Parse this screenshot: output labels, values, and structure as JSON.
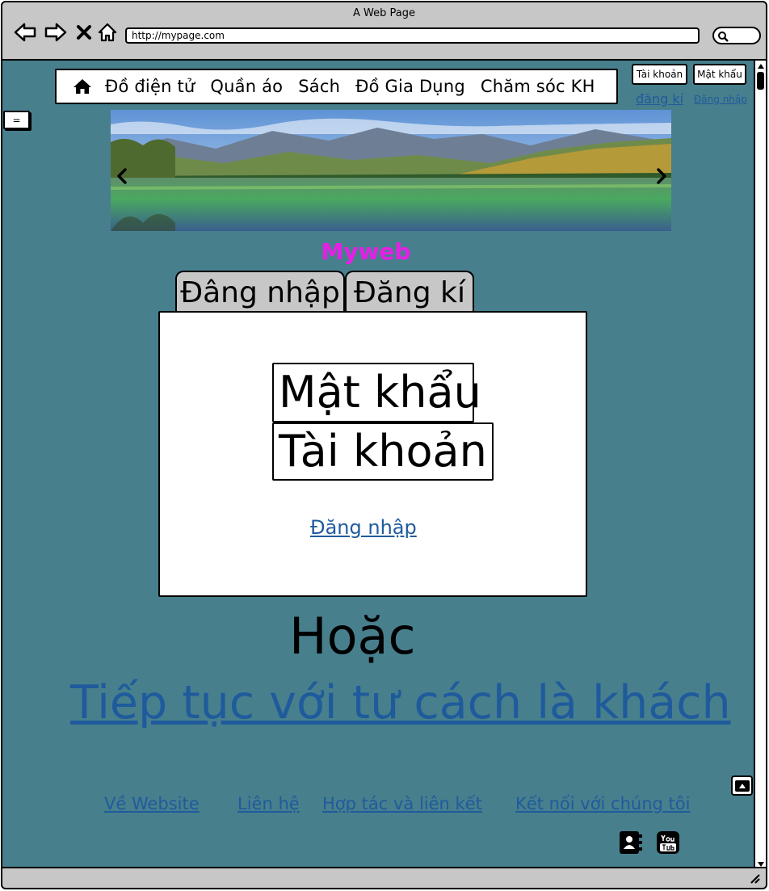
{
  "window": {
    "title": "A Web Page",
    "url": "http://mypage.com"
  },
  "nav": {
    "items": [
      "Đồ điện tử",
      "Quần áo",
      "Sách",
      "Đồ Gia Dụng",
      "Chăm sóc KH"
    ]
  },
  "account": {
    "username_button": "Tài khoản",
    "password_button": "Mật khẩu",
    "register_link": "đăng kí",
    "login_link": "Đăng nhập"
  },
  "sidebar_toggle": "=",
  "brand": "Myweb",
  "tabs": [
    "Đâng nhập",
    "Đăng kí"
  ],
  "login_form": {
    "password_field": "Mật khẩu",
    "username_field": "Tài khoản",
    "submit_link": "Đăng nhập"
  },
  "separator": "Hoặc",
  "guest_link": "Tiếp tục với tư cách là khách",
  "footer": {
    "links": [
      "Về Website",
      "Liên hệ",
      "Hợp tác và liên kết",
      "Kết nối với chúng tôi"
    ]
  },
  "icons": {
    "back": "back-arrow-icon",
    "forward": "forward-arrow-icon",
    "close": "close-icon",
    "home": "home-icon",
    "search": "search-icon",
    "contacts": "address-book-icon",
    "youtube": "youtube-icon",
    "scroll_top": "scroll-to-top-icon"
  },
  "colors": {
    "page_background": "#477f8d",
    "brand_text": "#e81ee8",
    "link": "#1f5b9c",
    "chrome": "#c7c7c7"
  }
}
